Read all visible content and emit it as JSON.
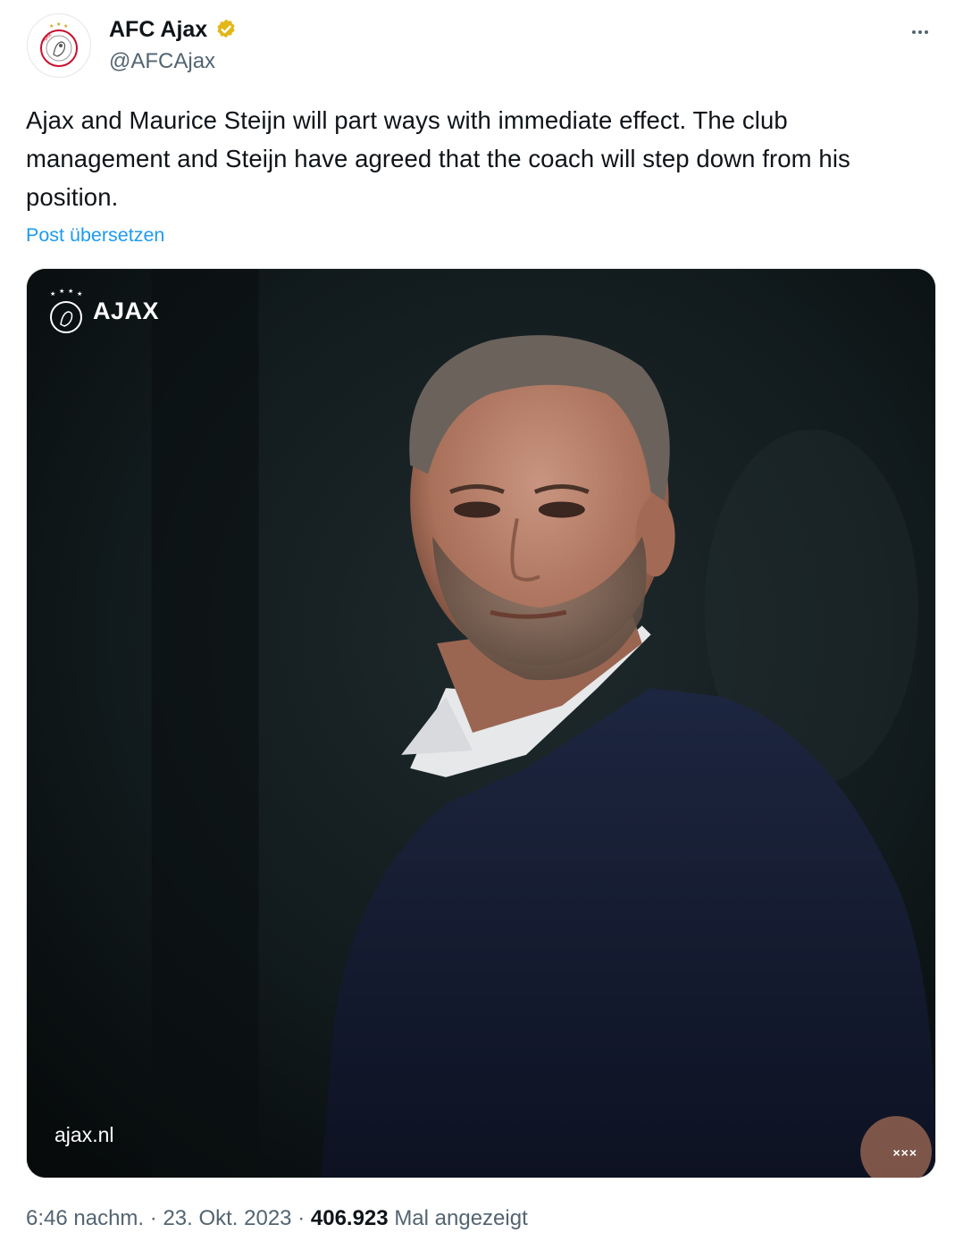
{
  "author": {
    "display_name": "AFC Ajax",
    "handle": "@AFCAjax",
    "verified": true,
    "avatar_icon": "ajax-crest-icon",
    "verified_icon": "verified-gold-badge-icon",
    "verified_color": "#e2b719"
  },
  "more_icon": "more-horizontal-icon",
  "tweet": {
    "text": "Ajax and Maurice Steijn will part ways with immediate effect. The club management and Steijn have agreed that the coach will step down from his position.",
    "translate_label": "Post übersetzen"
  },
  "media": {
    "watermark_logo_text": "AJAX",
    "watermark_site": "ajax.nl",
    "watermark_mark": "×××",
    "description": "portrait-photo"
  },
  "meta": {
    "time": "6:46 nachm.",
    "separator": "·",
    "date": "23. Okt. 2023",
    "views_count": "406.923",
    "views_label": "Mal angezeigt"
  },
  "colors": {
    "link": "#1d9bf0",
    "secondary_text": "#536471",
    "primary_text": "#0f1419"
  }
}
